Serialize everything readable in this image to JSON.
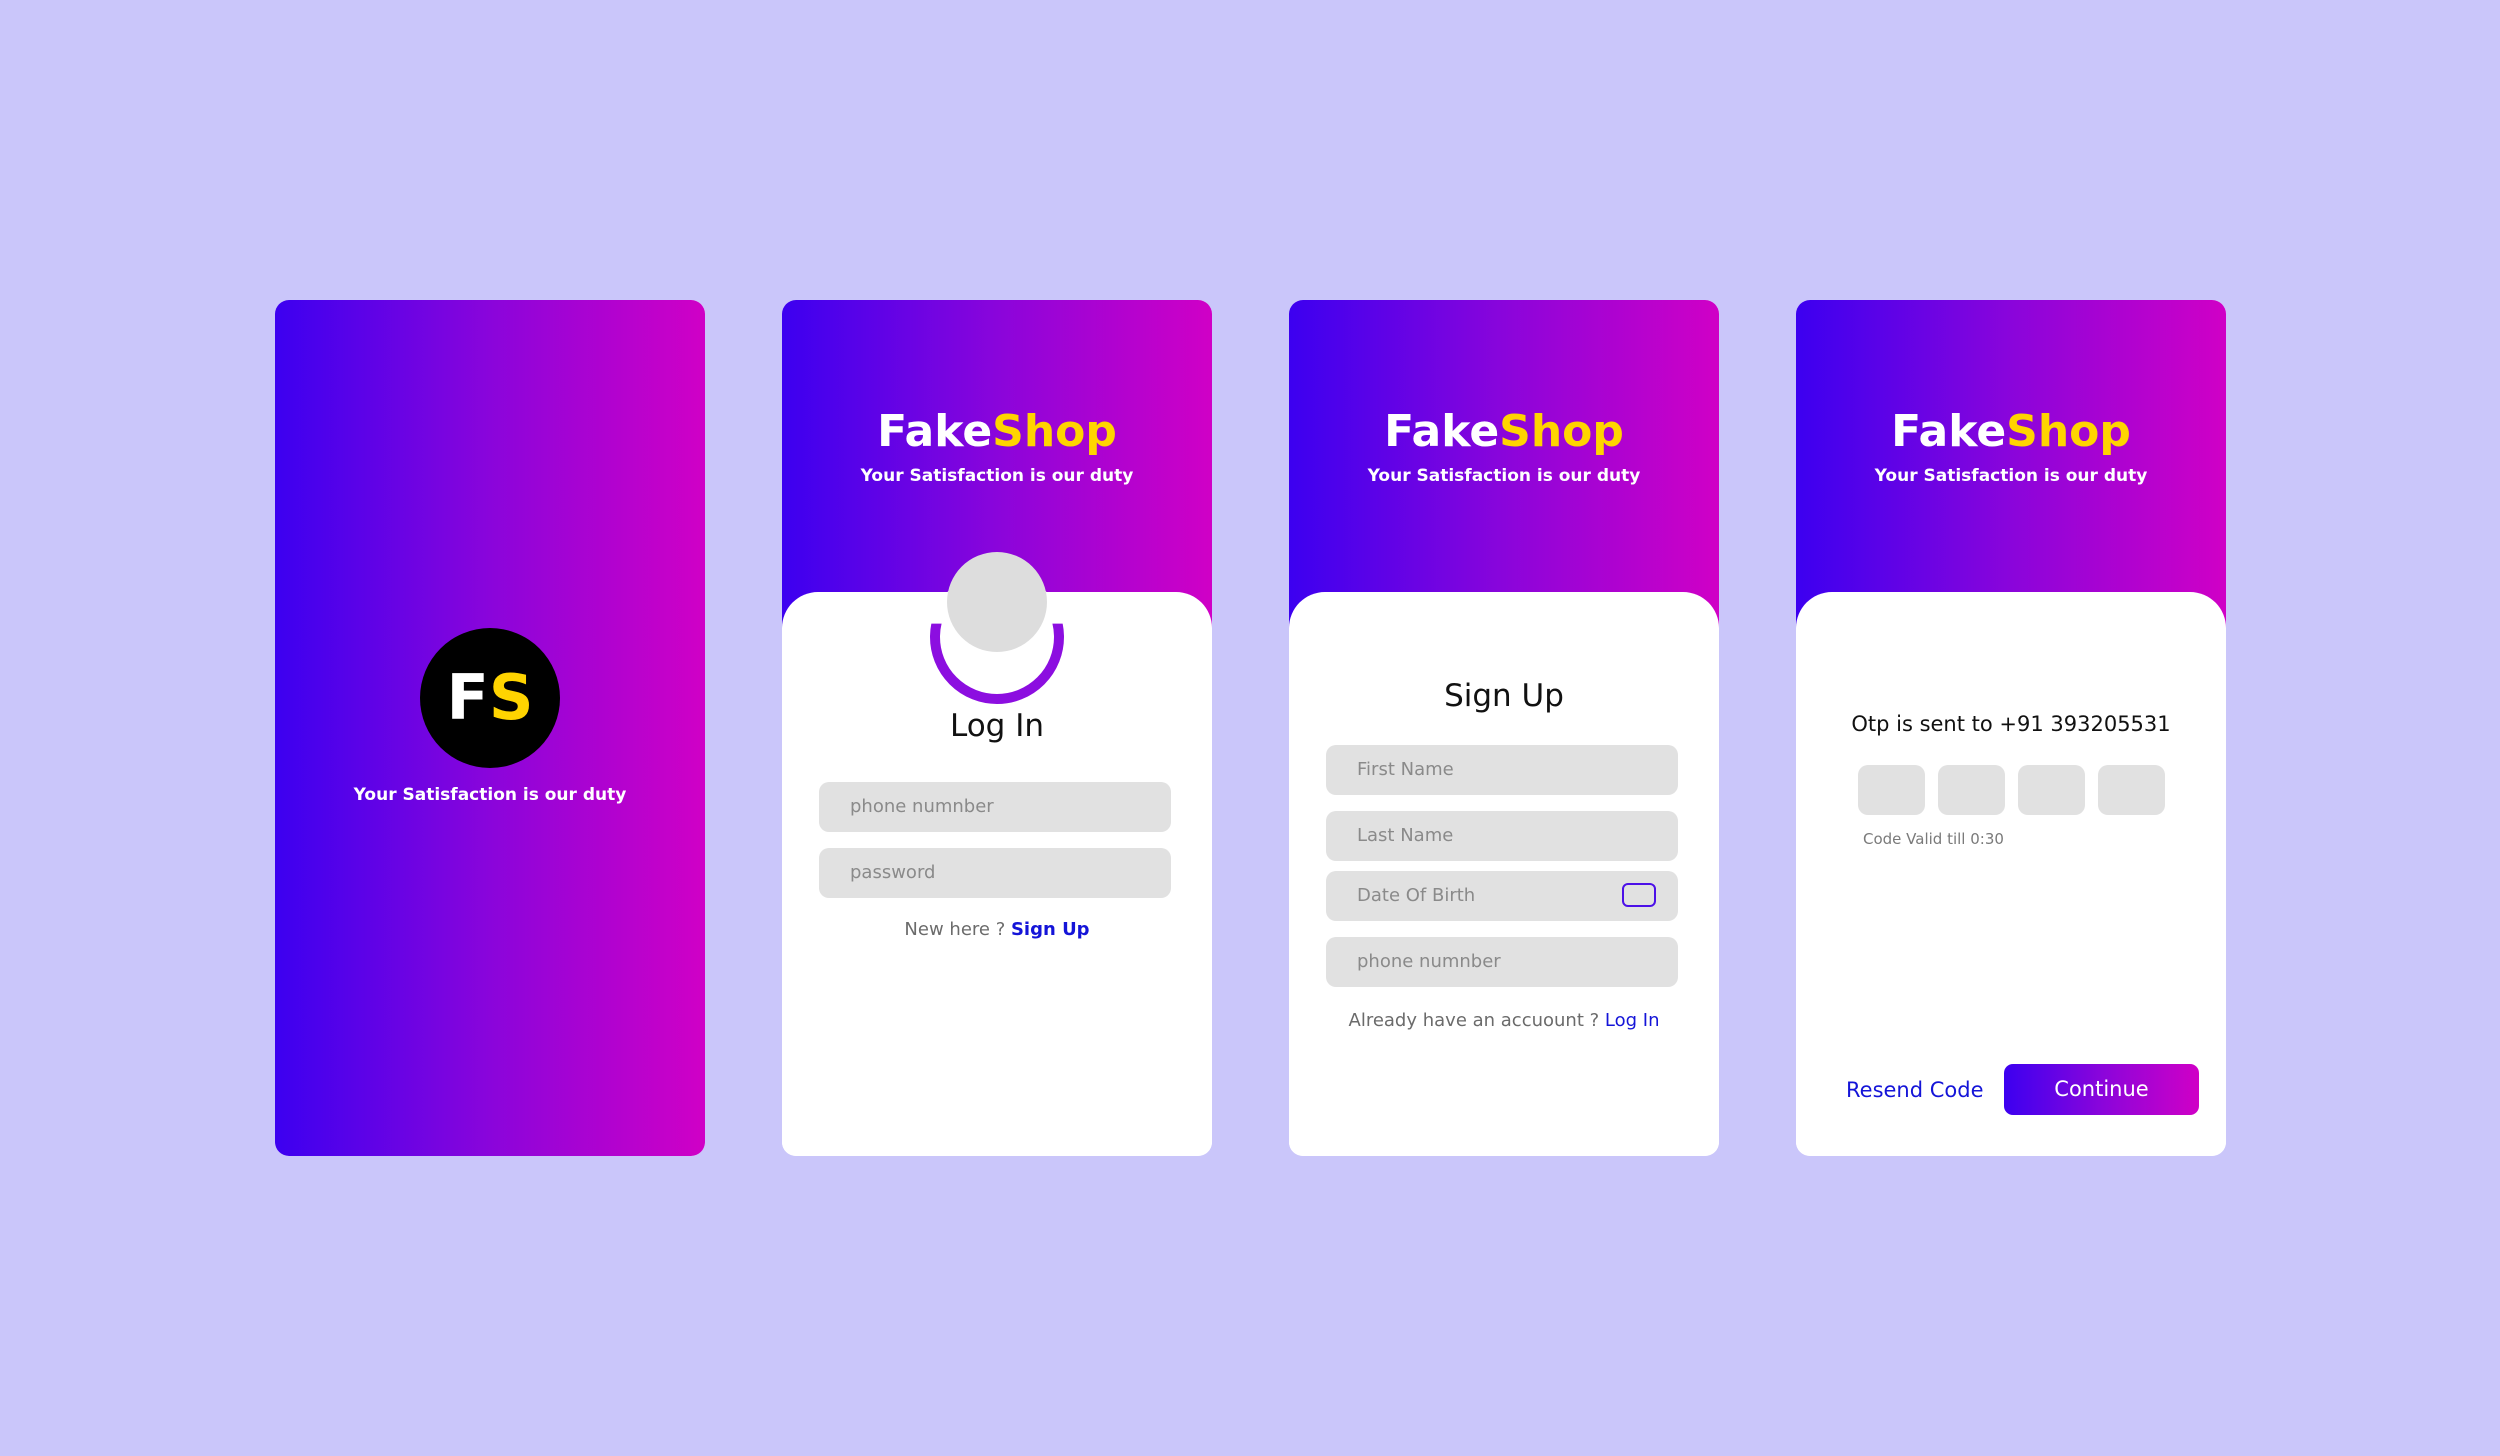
{
  "colors": {
    "background": "#cac6fa",
    "gradient_start": "#3c00f0",
    "gradient_end": "#d000c6",
    "accent_yellow": "#ffd400",
    "link_blue": "#1414d8",
    "field_grey": "#e1e1e1"
  },
  "splash": {
    "logo_f": "F",
    "logo_s": "S",
    "tagline": "Your Satisfaction is our duty"
  },
  "brand": {
    "fake": "Fake",
    "shop": "Shop",
    "tagline": "Your Satisfaction is our duty"
  },
  "login": {
    "title": "Log In",
    "phone_placeholder": "phone numnber",
    "password_placeholder": "password",
    "prompt": "New here ? ",
    "signup_link": "Sign Up"
  },
  "signup": {
    "title": "Sign Up",
    "first_name_placeholder": "First Name",
    "last_name_placeholder": "Last Name",
    "dob_placeholder": "Date Of Birth",
    "phone_placeholder": "phone numnber",
    "prompt": "Already have an accuount ? ",
    "login_link": "Log In"
  },
  "otp": {
    "message": "Otp is sent to +91 393205531",
    "code_valid": "Code Valid till 0:30",
    "resend_label": "Resend Code",
    "continue_label": "Continue"
  }
}
